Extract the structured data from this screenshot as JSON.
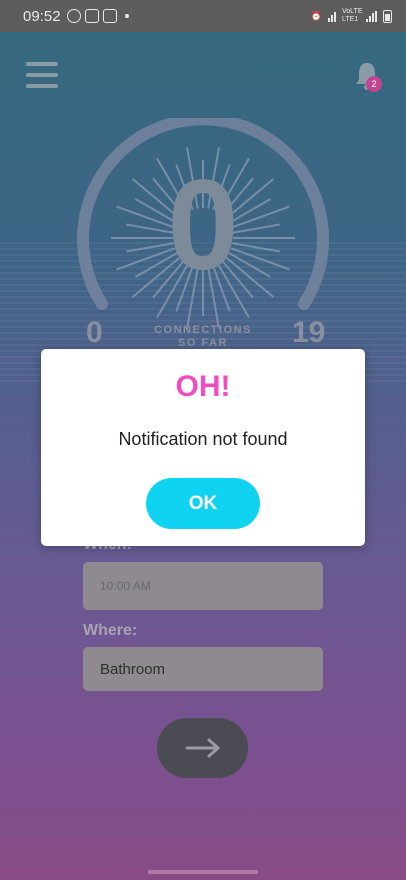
{
  "status_bar": {
    "time": "09:52",
    "network_label": "VoLTE LTE1"
  },
  "header": {
    "menu_icon": "hamburger-menu-icon",
    "notification_icon": "bell-icon",
    "notification_count": "2"
  },
  "gauge": {
    "value": "0",
    "min": "0",
    "max": "19",
    "label": "CONNECTIONS SO FAR"
  },
  "form": {
    "when_label": "When:",
    "time_value": "10:00 AM",
    "where_label": "Where:",
    "where_value": "Bathroom",
    "next_icon": "arrow-right-icon"
  },
  "dialog": {
    "title": "OH!",
    "message": "Notification not found",
    "ok_label": "OK"
  },
  "colors": {
    "accent_pink": "#f04dc1",
    "ok_cyan": "#0fd3f0",
    "badge": "#c2468f"
  }
}
